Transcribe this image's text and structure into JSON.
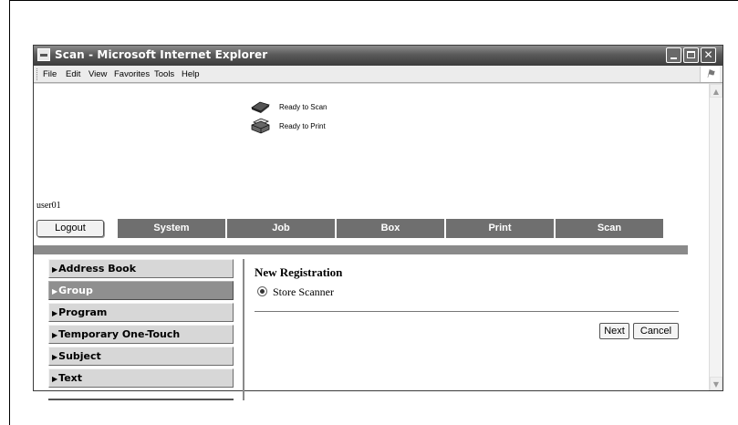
{
  "window": {
    "title": "Scan - Microsoft Internet Explorer",
    "controls": {
      "minimize": "minimize",
      "maximize": "maximize",
      "close": "✕"
    }
  },
  "menubar": {
    "items": [
      "File",
      "Edit",
      "View",
      "Favorites",
      "Tools",
      "Help"
    ]
  },
  "status": {
    "scan": "Ready to Scan",
    "print": "Ready to Print"
  },
  "user": {
    "name": "user01"
  },
  "logout_label": "Logout",
  "tabs": [
    "System",
    "Job",
    "Box",
    "Print",
    "Scan"
  ],
  "sidebar": {
    "items": [
      {
        "label": "Address Book",
        "selected": false
      },
      {
        "label": "Group",
        "selected": true
      },
      {
        "label": "Program",
        "selected": false
      },
      {
        "label": "Temporary One-Touch",
        "selected": false
      },
      {
        "label": "Subject",
        "selected": false
      },
      {
        "label": "Text",
        "selected": false
      }
    ],
    "arrow": "▶"
  },
  "main": {
    "title": "New Registration",
    "option": "Store Scanner",
    "next_label": "Next",
    "cancel_label": "Cancel"
  },
  "colors": {
    "tab_bg": "#6f6f6f",
    "selected_item_bg": "#8f8f8f",
    "titlebar_dark": "#3c3c3c"
  },
  "icons": {
    "scanner": "scanner-icon",
    "printer": "printer-icon"
  }
}
